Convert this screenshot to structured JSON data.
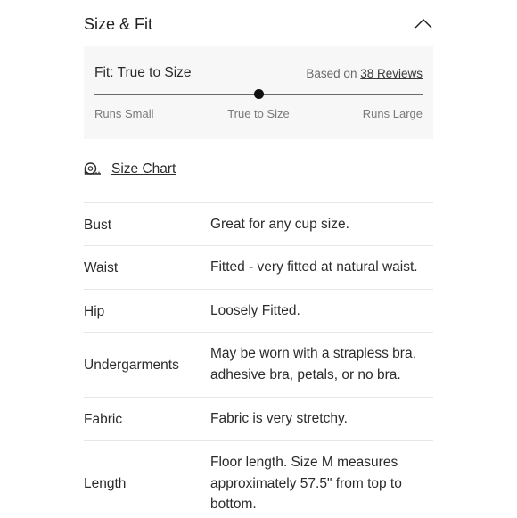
{
  "section": {
    "title": "Size & Fit"
  },
  "fit": {
    "label": "Fit: True to Size",
    "based_on_prefix": "Based on",
    "reviews_link": "38 Reviews",
    "position": 0.5,
    "scale": {
      "low": "Runs Small",
      "mid": "True to Size",
      "high": "Runs Large"
    }
  },
  "size_chart": {
    "label": "Size Chart",
    "icon": "measuring-tape-icon"
  },
  "specs": [
    {
      "name": "Bust",
      "value": "Great for any cup size."
    },
    {
      "name": "Waist",
      "value": "Fitted - very fitted at natural waist."
    },
    {
      "name": "Hip",
      "value": "Loosely Fitted."
    },
    {
      "name": "Undergarments",
      "value": "May be worn with a strapless bra, adhesive bra, petals, or no bra."
    },
    {
      "name": "Fabric",
      "value": "Fabric is very stretchy."
    },
    {
      "name": "Length",
      "value": "Floor length. Size M measures approximately 57.5\" from top to bottom."
    }
  ]
}
